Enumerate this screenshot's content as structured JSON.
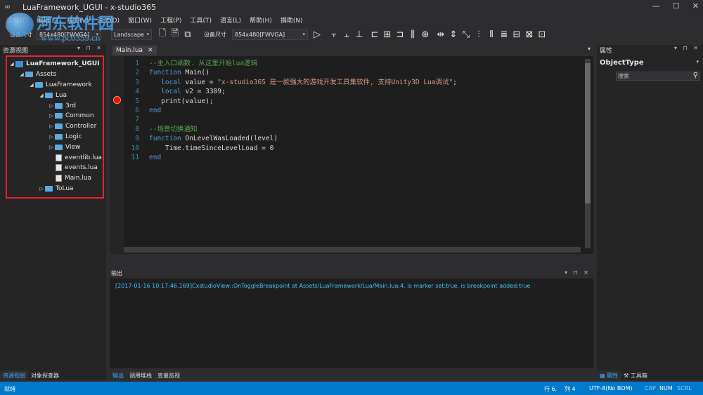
{
  "window": {
    "title": "LuaFramework_UGUI - x-studio365",
    "controls": [
      "—",
      "☐",
      "✕"
    ]
  },
  "menu": [
    "文件(F)",
    "编辑(E)",
    "视图(V)",
    "调试(D)",
    "窗口(W)",
    "工程(P)",
    "工具(T)",
    "语言(L)",
    "帮助(H)",
    "捐助(N)"
  ],
  "watermark": {
    "text": "河东软件园",
    "url": "www.pc0359.cn"
  },
  "toolbar": {
    "left_label": "设备尺寸",
    "resolution_left": "854x480[FWVGA]",
    "orientation": "Landscape",
    "device_label": "设备尺寸",
    "resolution_right": "854x480[FWVGA]"
  },
  "left_panel": {
    "title": "资源视图",
    "tree": [
      {
        "label": "LuaFramework_UGUI",
        "indent": 0,
        "arrow": "◢",
        "icon": "root",
        "bold": true
      },
      {
        "label": "Assets",
        "indent": 1,
        "arrow": "◢",
        "icon": "folder"
      },
      {
        "label": "LuaFramework",
        "indent": 2,
        "arrow": "◢",
        "icon": "folder"
      },
      {
        "label": "Lua",
        "indent": 3,
        "arrow": "◢",
        "icon": "folder"
      },
      {
        "label": "3rd",
        "indent": 4,
        "arrow": "▷",
        "icon": "folder"
      },
      {
        "label": "Common",
        "indent": 4,
        "arrow": "▷",
        "icon": "folder"
      },
      {
        "label": "Controller",
        "indent": 4,
        "arrow": "▷",
        "icon": "folder"
      },
      {
        "label": "Logic",
        "indent": 4,
        "arrow": "▷",
        "icon": "folder"
      },
      {
        "label": "View",
        "indent": 4,
        "arrow": "▷",
        "icon": "folder"
      },
      {
        "label": "eventlib.lua",
        "indent": 4,
        "arrow": "",
        "icon": "file"
      },
      {
        "label": "events.lua",
        "indent": 4,
        "arrow": "",
        "icon": "file"
      },
      {
        "label": "Main.lua",
        "indent": 4,
        "arrow": "",
        "icon": "file"
      },
      {
        "label": "ToLua",
        "indent": 3,
        "arrow": "▷",
        "icon": "folder"
      }
    ],
    "tabs": [
      "资源视图",
      "对象探查器"
    ]
  },
  "editor": {
    "tab_label": "Main.lua",
    "lines": [
      {
        "n": "1",
        "parts": [
          [
            "cm",
            "--主入口函数. 从这里开始lua逻辑"
          ]
        ]
      },
      {
        "n": "2",
        "parts": [
          [
            "kw",
            "function"
          ],
          [
            "txt",
            " Main()"
          ]
        ]
      },
      {
        "n": "3",
        "parts": [
          [
            "txt",
            "   "
          ],
          [
            "kw",
            "local"
          ],
          [
            "txt",
            " value = "
          ],
          [
            "str",
            "\"x-studio365 是一款强大的游戏开发工具集软件, 支持Unity3D Lua调试\""
          ],
          [
            "txt",
            ";"
          ]
        ]
      },
      {
        "n": "4",
        "parts": [
          [
            "txt",
            "   "
          ],
          [
            "kw",
            "local"
          ],
          [
            "txt",
            " v2 = 3389;"
          ]
        ]
      },
      {
        "n": "5",
        "parts": [
          [
            "txt",
            "   print(value);"
          ]
        ]
      },
      {
        "n": "6",
        "parts": [
          [
            "kw",
            "end"
          ]
        ]
      },
      {
        "n": "7",
        "parts": [
          [
            "txt",
            ""
          ]
        ]
      },
      {
        "n": "8",
        "parts": [
          [
            "cm",
            "--场景切换通知"
          ]
        ]
      },
      {
        "n": "9",
        "parts": [
          [
            "kw",
            "function"
          ],
          [
            "txt",
            " OnLevelWasLoaded(level)"
          ]
        ]
      },
      {
        "n": "10",
        "parts": [
          [
            "txt",
            "    Time.timeSinceLevelLoad = 0"
          ]
        ]
      },
      {
        "n": "11",
        "parts": [
          [
            "kw",
            "end"
          ]
        ]
      }
    ]
  },
  "output": {
    "title": "输出",
    "log": "[2017-01-16 10:17:46.169]CxstudioView::OnToggleBreakpoint at Assets/LuaFramework/Lua/Main.lua:4, is marker set:true, is breakpoint added:true",
    "tabs": [
      "输出",
      "调用堆栈",
      "变量监视"
    ]
  },
  "right_panel": {
    "title": "属性",
    "object_type": "ObjectType",
    "search_placeholder": "搜索",
    "tabs": [
      "属性",
      "工具箱"
    ]
  },
  "status": {
    "ready": "就绪",
    "row": "行 6,",
    "col": "列 4",
    "encoding": "UTF-8(No BOM)",
    "cap": "CAP",
    "num": "NUM",
    "scrl": "SCRL"
  }
}
